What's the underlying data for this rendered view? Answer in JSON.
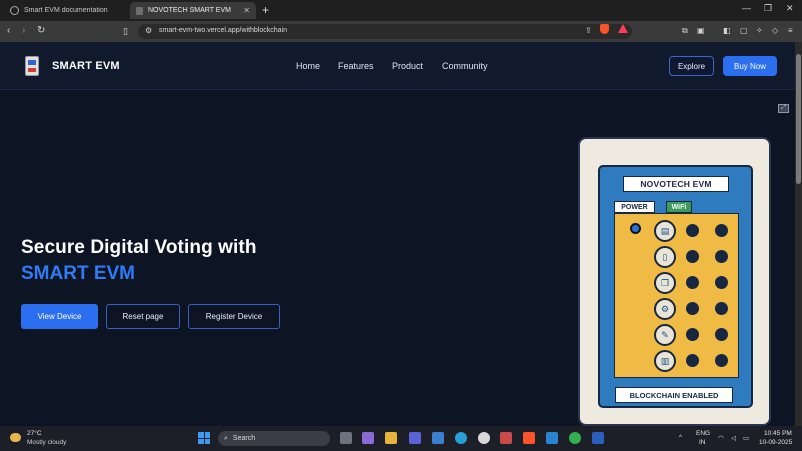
{
  "browser": {
    "tabs": [
      {
        "title": "Smart EVM documentation",
        "active": false
      },
      {
        "title": "NOVOTECH SMART EVM",
        "active": true
      }
    ],
    "url": "smart-evm-two.vercel.app/withblockchain"
  },
  "site": {
    "brand": "SMART EVM",
    "nav": [
      "Home",
      "Features",
      "Product",
      "Community"
    ],
    "explore_label": "Explore",
    "buy_label": "Buy Now",
    "hero_line1": "Secure Digital Voting with",
    "hero_line2": "SMART EVM",
    "buttons": {
      "view": "View Device",
      "reset": "Reset page",
      "register": "Register Device"
    }
  },
  "evm": {
    "title": "NOVOTECH EVM",
    "power_label": "POWER",
    "wifi_label": "WiFi",
    "footer": "BLOCKCHAIN ENABLED",
    "candidate_symbols": [
      "book-icon",
      "phone-icon",
      "open-book-icon",
      "gears-icon",
      "pen-icon",
      "books-icon"
    ],
    "led_color": "#2f6fe0"
  },
  "taskbar": {
    "temperature": "27°C",
    "condition": "Mostly cloudy",
    "search_placeholder": "Search",
    "lang": "ENG",
    "region": "IN",
    "time": "10:45 PM",
    "date": "10-09-2025"
  },
  "colors": {
    "accent": "#2b6ff0",
    "hero_highlight": "#2e7bf5",
    "page_bg": "#0d1424"
  }
}
